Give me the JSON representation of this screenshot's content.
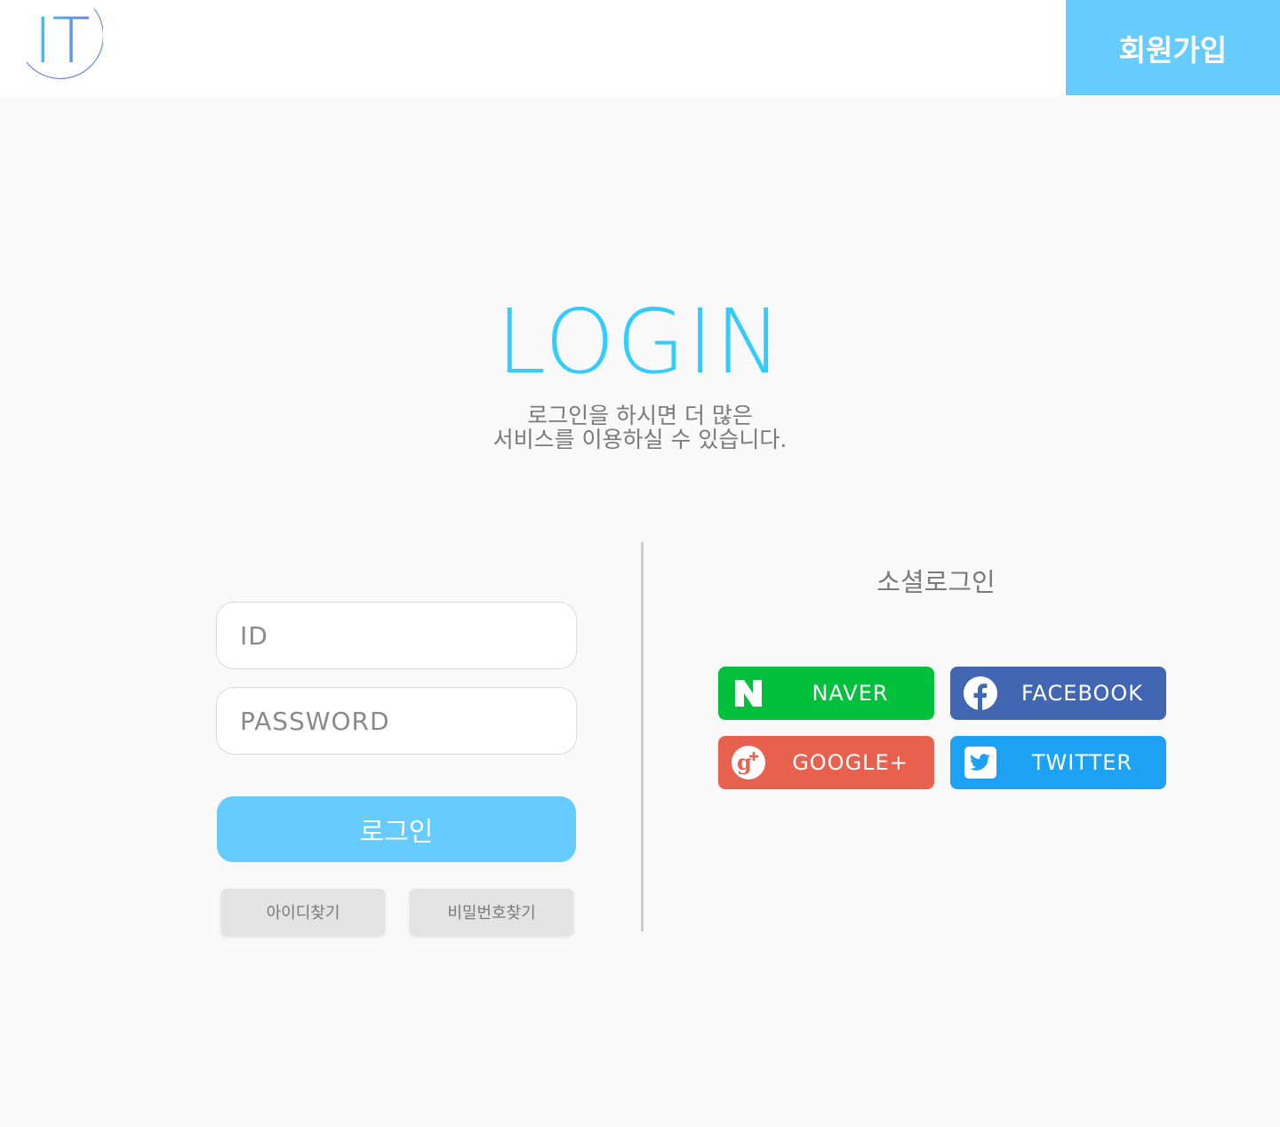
{
  "header": {
    "logo_text": "IT",
    "signup_label": "회원가입"
  },
  "main": {
    "title": "LOGIN",
    "subtitle_line1": "로그인을 하시면 더 많은",
    "subtitle_line2": "서비스를 이용하실 수 있습니다."
  },
  "form": {
    "id_placeholder": "ID",
    "password_placeholder": "PASSWORD",
    "login_label": "로그인",
    "find_id_label": "아이디찾기",
    "find_password_label": "비밀번호찾기"
  },
  "social": {
    "title": "소셜로그인",
    "buttons": [
      {
        "label": "NAVER",
        "icon": "naver-icon",
        "color": "#03c03c"
      },
      {
        "label": "FACEBOOK",
        "icon": "facebook-icon",
        "color": "#4267b2"
      },
      {
        "label": "GOOGLE+",
        "icon": "google-plus-icon",
        "color": "#e8614f"
      },
      {
        "label": "TWITTER",
        "icon": "twitter-icon",
        "color": "#1da1f2"
      }
    ]
  },
  "colors": {
    "accent": "#66ccff",
    "title": "#33ccff",
    "background": "#f9f9f9"
  }
}
